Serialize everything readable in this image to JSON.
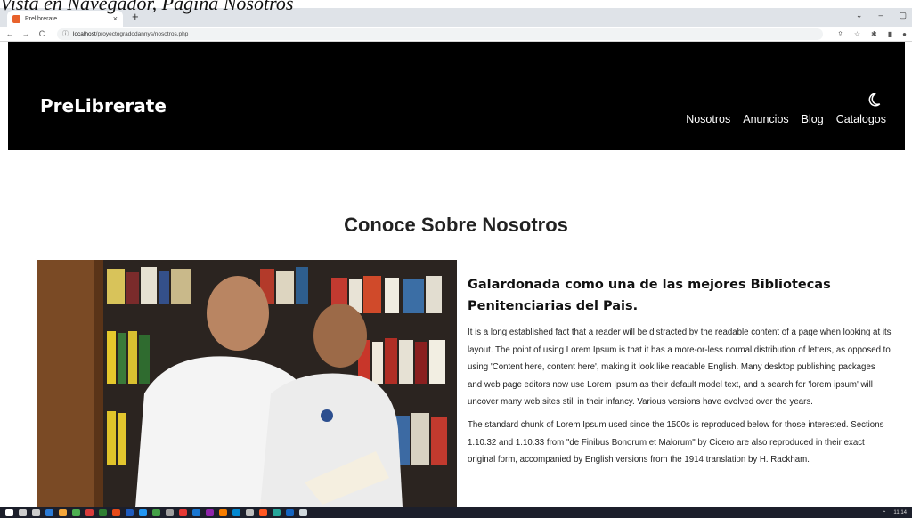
{
  "caption": "Vista en Navegador, Página Nosotros",
  "browser": {
    "tab_title": "Prelibrerate",
    "tab_close": "×",
    "new_tab": "+",
    "window_controls": [
      "⌄",
      "–",
      "▢"
    ],
    "url_host": "localhost",
    "url_path": "/proyectogradodannys/nosotros.php",
    "nav": {
      "back": "←",
      "forward": "→",
      "reload": "C"
    }
  },
  "site": {
    "brand": "PreLibrerate",
    "nav_items": [
      "Nosotros",
      "Anuncios",
      "Blog",
      "Catalogos"
    ]
  },
  "content": {
    "section_title": "Conoce Sobre Nosotros",
    "award_heading": "Galardonada como una de las mejores Bibliotecas Penitenciarias del Pais.",
    "paragraph_1": "It is a long established fact that a reader will be distracted by the readable content of a page when looking at its layout. The point of using Lorem Ipsum is that it has a more-or-less normal distribution of letters, as opposed to using 'Content here, content here', making it look like readable English. Many desktop publishing packages and web page editors now use Lorem Ipsum as their default model text, and a search for 'lorem ipsum' will uncover many web sites still in their infancy. Various versions have evolved over the years.",
    "paragraph_2": "The standard chunk of Lorem Ipsum used since the 1500s is reproduced below for those interested. Sections 1.10.32 and 1.10.33 from \"de Finibus Bonorum et Malorum\" by Cicero are also reproduced in their exact original form, accompanied by English versions from the 1914 translation by H. Rackham."
  },
  "taskbar": {
    "clock": "11:14",
    "icon_colors": [
      "#ffffff",
      "#cccccc",
      "#cccccc",
      "#2b7bd6",
      "#f2a53a",
      "#4caf50",
      "#d83b3b",
      "#2e7d32",
      "#e64a19",
      "#1e5bbf",
      "#2196f3",
      "#43a047",
      "#9e9e9e",
      "#e53935",
      "#1976d2",
      "#8e24aa",
      "#f57c00",
      "#0288d1",
      "#bdbdbd",
      "#ff5722",
      "#26a69a",
      "#1565c0",
      "#cfd8dc"
    ]
  }
}
